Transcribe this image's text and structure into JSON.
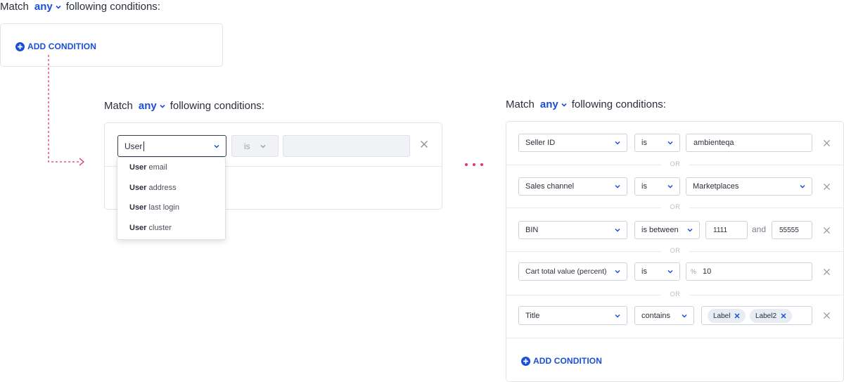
{
  "top_group": {
    "match_prefix": "Match",
    "match_value": "any",
    "match_suffix": "following conditions:",
    "add_condition_label": "ADD CONDITION"
  },
  "middle_group": {
    "match_prefix": "Match",
    "match_value": "any",
    "match_suffix": "following conditions:",
    "field_value": "User",
    "operator_value": "is",
    "value_input": "",
    "dropdown_options": [
      {
        "bold": "User",
        "rest": " email"
      },
      {
        "bold": "User",
        "rest": " address"
      },
      {
        "bold": "User",
        "rest": " last login"
      },
      {
        "bold": "User",
        "rest": " cluster"
      }
    ]
  },
  "right_group": {
    "match_prefix": "Match",
    "match_value": "any",
    "match_suffix": "following conditions:",
    "or_label": "OR",
    "rows": [
      {
        "field": "Seller ID",
        "operator": "is",
        "value": "ambienteqa"
      },
      {
        "field": "Sales channel",
        "operator": "is",
        "value": "Marketplaces"
      },
      {
        "field": "BIN",
        "operator": "is between",
        "value_from": "1111",
        "and_label": "and",
        "value_to": "55555"
      },
      {
        "field": "Cart total value (percent)",
        "operator": "is",
        "value_prefix": "%",
        "value": "10"
      },
      {
        "field": "Title",
        "operator": "contains",
        "chips": [
          "Label",
          "Label2"
        ]
      }
    ],
    "add_condition_label": "ADD CONDITION"
  },
  "colors": {
    "accent": "#1a4fd6",
    "connector": "#e8336e",
    "border": "#e1e4ea"
  },
  "icons": {
    "chevron": "chevron-down-icon",
    "close": "close-icon",
    "add": "plus-circle-icon"
  }
}
